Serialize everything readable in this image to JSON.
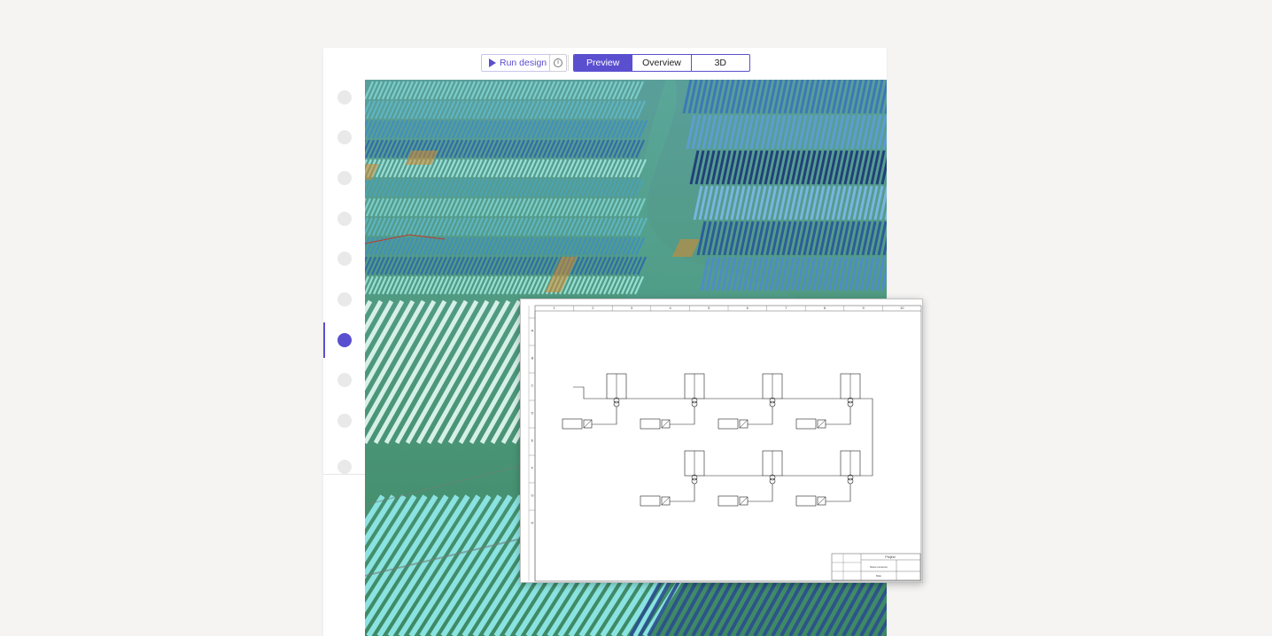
{
  "toolbar": {
    "run_label": "Run design",
    "info_icon": "info-icon",
    "tabs": [
      {
        "label": "Preview",
        "active": true
      },
      {
        "label": "Overview",
        "active": false
      },
      {
        "label": "3D",
        "active": false
      }
    ]
  },
  "sidebar": {
    "active_index": 6,
    "item_count": 10
  },
  "schematic": {
    "columns": [
      "1",
      "2",
      "3",
      "4",
      "5",
      "6",
      "7",
      "8",
      "9",
      "10"
    ],
    "rows": [
      "A",
      "B",
      "C",
      "D",
      "E",
      "F",
      "G",
      "H"
    ],
    "title_block": {
      "project": "Project",
      "drawing": "Name someone",
      "sheet": "Date"
    }
  },
  "colors": {
    "accent": "#5a4fcf",
    "terrain": "#3f8a6a",
    "panel_light": "#8fe3e0",
    "panel_dark": "#1d3f7a"
  }
}
